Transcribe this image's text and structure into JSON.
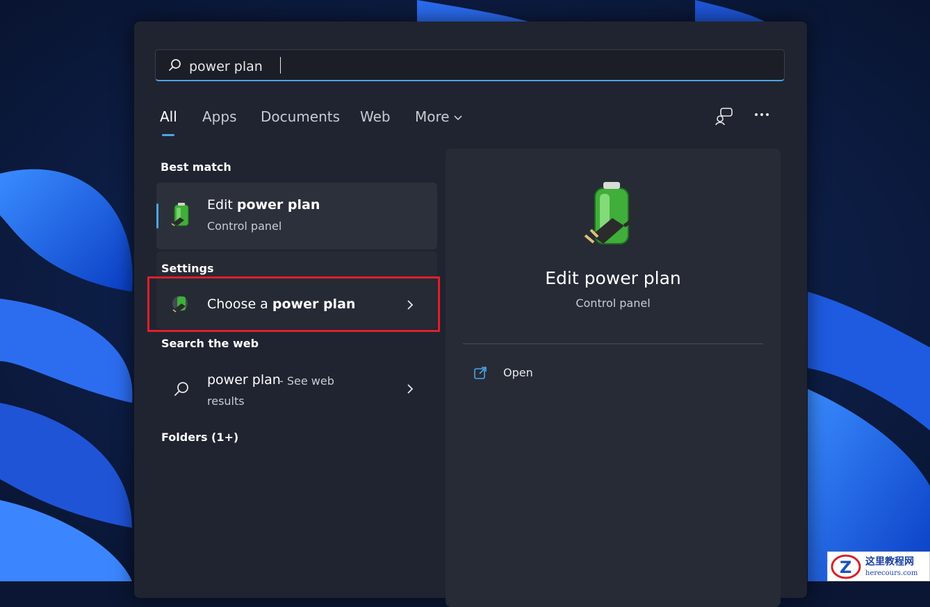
{
  "search": {
    "query": "power plan"
  },
  "tabs": [
    {
      "label": "All",
      "active": true
    },
    {
      "label": "Apps"
    },
    {
      "label": "Documents"
    },
    {
      "label": "Web"
    },
    {
      "label": "More"
    }
  ],
  "top_icons": [
    "feedback-icon",
    "more-options-icon"
  ],
  "best_match": {
    "header": "Best match",
    "title_prefix": "Edit ",
    "title_bold": "power plan",
    "subtitle": "Control panel",
    "icon": "power-plan-battery-icon"
  },
  "settings": {
    "header": "Settings",
    "title_prefix": "Choose a ",
    "title_bold": "power plan",
    "icon": "power-plan-settings-icon"
  },
  "web": {
    "header": "Search the web",
    "query_text": "power plan",
    "suffix": " - See web",
    "suffix_line2": "results",
    "icon": "search-icon"
  },
  "folders": {
    "header": "Folders (1+)"
  },
  "preview": {
    "title": "Edit power plan",
    "subtitle": "Control panel",
    "open_label": "Open",
    "icon": "power-plan-battery-icon"
  },
  "watermark": {
    "cn": "这里教程网",
    "site": "herecours.com"
  },
  "colors": {
    "accent": "#4aa6e6",
    "highlight": "#e21e2b",
    "panel": "#202430"
  }
}
